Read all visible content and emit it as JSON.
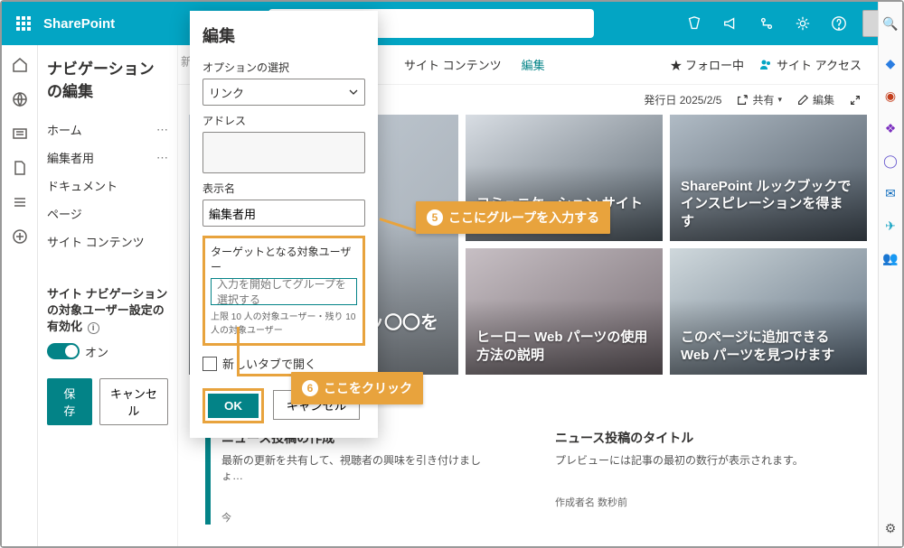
{
  "suite": {
    "app_name": "SharePoint"
  },
  "nav": {
    "title": "ナビゲーションの編集",
    "items": [
      "ホーム",
      "編集者用",
      "ドキュメント",
      "ページ",
      "サイト コンテンツ"
    ],
    "audience_label": "サイト ナビゲーションの対象ユーザー設定の有効化",
    "toggle_state": "オン",
    "save": "保存",
    "cancel": "キャンセル"
  },
  "cmdbar": {
    "site_contents": "サイト コンテンツ",
    "edit": "編集",
    "follow": "フォロー中",
    "site_access": "サイト アクセス",
    "pub_date": "発行日 2025/2/5",
    "share": "共有",
    "edit2": "編集"
  },
  "hero": {
    "left": "〇〇〇〇〇〇〇〇リッ〇〇を開始します",
    "tiles": [
      "コミュニケーション サイトについての詳細",
      "SharePoint ルックブックでインスピレーションを得ます",
      "ヒーロー Web パーツの使用方法の説明",
      "このページに追加できる Web パーツを見つけます"
    ]
  },
  "news": {
    "col1_title": "ニュース投稿の作成",
    "col1_desc": "最新の更新を共有して、視聴者の興味を引き付けましょ…",
    "col1_meta": "今",
    "col2_title": "ニュース投稿のタイトル",
    "col2_desc": "プレビューには記事の最初の数行が表示されます。",
    "col2_meta": "作成者名  数秒前"
  },
  "dialog": {
    "title": "編集",
    "option_label": "オプションの選択",
    "option_value": "リンク",
    "address_label": "アドレス",
    "displayname_label": "表示名",
    "displayname_value": "編集者用",
    "target_label": "ターゲットとなる対象ユーザー",
    "target_placeholder": "入力を開始してグループを選択する",
    "target_hint": "上限 10 人の対象ユーザー・残り 10 人の対象ユーザー",
    "newtab_label": "新しいタブで開く",
    "ok": "OK",
    "cancel": "キャンセル"
  },
  "callouts": {
    "c1": "ここにグループを入力する",
    "c2": "ここをクリック"
  }
}
